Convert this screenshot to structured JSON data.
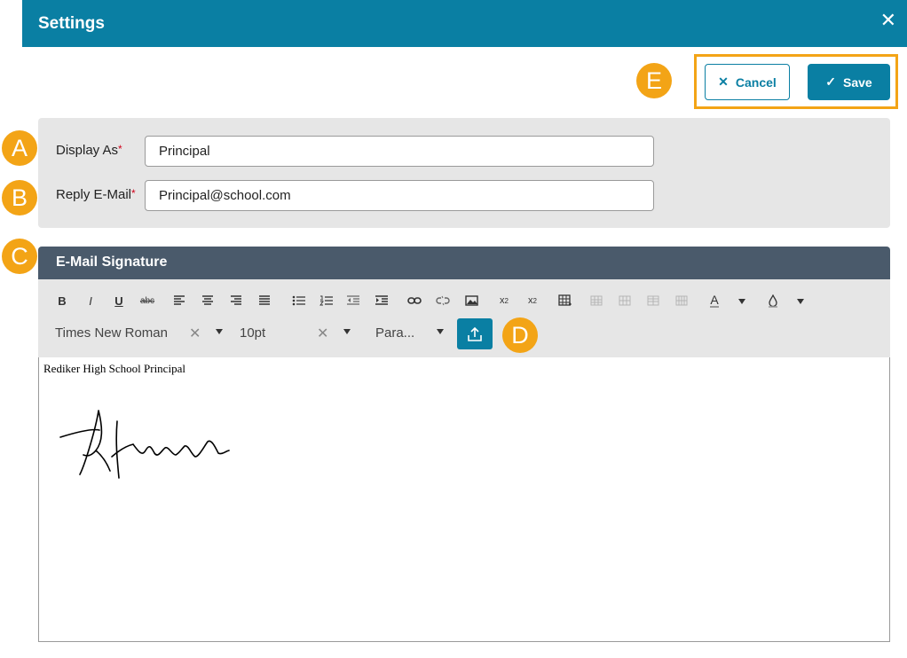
{
  "header": {
    "title": "Settings",
    "close_icon": "close-icon"
  },
  "actions": {
    "cancel_label": "Cancel",
    "save_label": "Save"
  },
  "badges": {
    "a": "A",
    "b": "B",
    "c": "C",
    "d": "D",
    "e": "E"
  },
  "form": {
    "display_as": {
      "label": "Display As",
      "required_mark": "*",
      "value": "Principal"
    },
    "reply_email": {
      "label": "Reply E-Mail",
      "required_mark": "*",
      "value": "Principal@school.com"
    }
  },
  "signature": {
    "title": "E-Mail Signature",
    "toolbar": {
      "bold": "B",
      "italic": "I",
      "underline": "U",
      "strikethrough": "abc",
      "font_family": "Times New Roman",
      "font_size": "10pt",
      "block_format": "Para..."
    },
    "editor_text": "Rediker High School Principal"
  },
  "colors": {
    "accent": "#0a7fa3",
    "badge": "#f3a416",
    "section_header": "#4a5a6b",
    "panel": "#e6e6e6"
  }
}
